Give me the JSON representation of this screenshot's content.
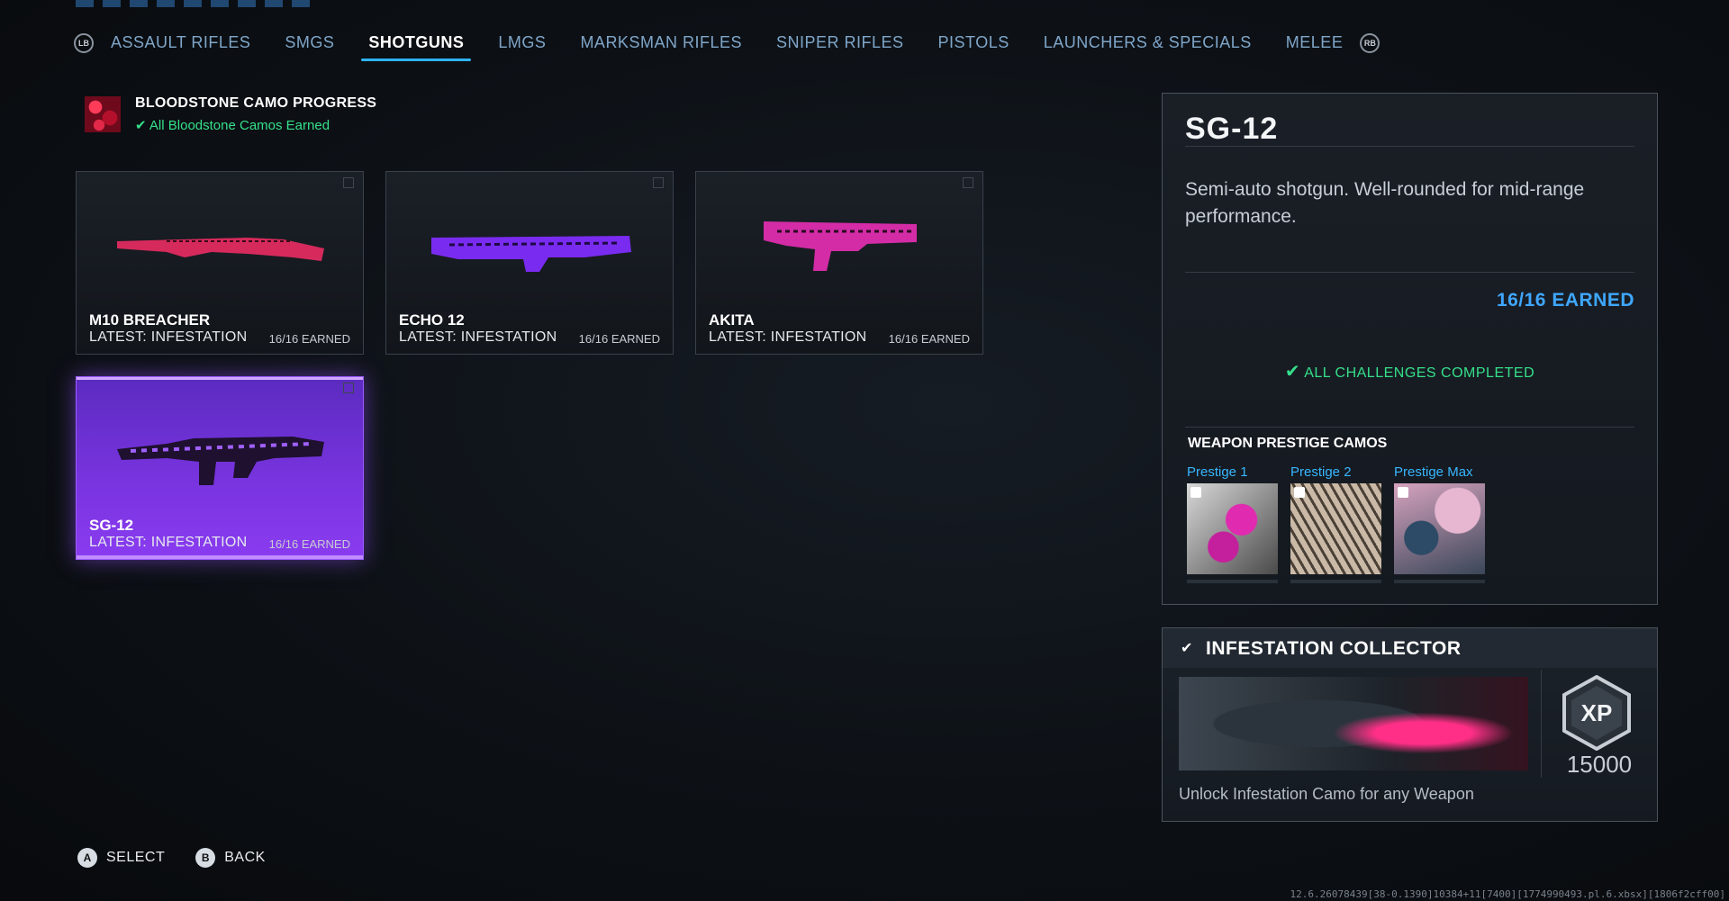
{
  "nav": {
    "left_bumper": "LB",
    "right_bumper": "RB",
    "tabs": [
      "ASSAULT RIFLES",
      "SMGS",
      "SHOTGUNS",
      "LMGS",
      "MARKSMAN RIFLES",
      "SNIPER RIFLES",
      "PISTOLS",
      "LAUNCHERS & SPECIALS",
      "MELEE"
    ],
    "active_tab": "SHOTGUNS"
  },
  "camo_progress": {
    "title": "BLOODSTONE CAMO PROGRESS",
    "status": "All Bloodstone Camos Earned"
  },
  "weapons": [
    {
      "name": "M10 BREACHER",
      "latest": "LATEST: INFESTATION",
      "earned": "16/16 EARNED",
      "camo_color": "#e0285e"
    },
    {
      "name": "ECHO 12",
      "latest": "LATEST: INFESTATION",
      "earned": "16/16 EARNED",
      "camo_color": "#7a2bf0"
    },
    {
      "name": "AKITA",
      "latest": "LATEST: INFESTATION",
      "earned": "16/16 EARNED",
      "camo_color": "#d32ca6"
    },
    {
      "name": "SG-12",
      "latest": "LATEST: INFESTATION",
      "earned": "16/16 EARNED",
      "camo_color": "#7a2bf0",
      "selected": true
    }
  ],
  "detail": {
    "title": "SG-12",
    "description": "Semi-auto shotgun. Well-rounded for mid-range performance.",
    "earned": "16/16 EARNED",
    "complete": "ALL CHALLENGES COMPLETED",
    "prestige_heading": "WEAPON PRESTIGE CAMOS",
    "prestige": [
      {
        "label": "Prestige 1"
      },
      {
        "label": "Prestige 2"
      },
      {
        "label": "Prestige Max"
      }
    ]
  },
  "challenge": {
    "title": "INFESTATION COLLECTOR",
    "xp_label": "XP",
    "xp_value": "15000",
    "description": "Unlock Infestation Camo for any Weapon"
  },
  "footer": {
    "select_key": "A",
    "select_label": "SELECT",
    "back_key": "B",
    "back_label": "BACK"
  },
  "build": "12.6.26078439[38-0.1390]10384+11[7400][1774990493.pl.6.xbsx][1806f2cff00]",
  "colors": {
    "accent": "#2fb3ff",
    "success": "#35e08a",
    "selected_card": "#7a34e0"
  }
}
